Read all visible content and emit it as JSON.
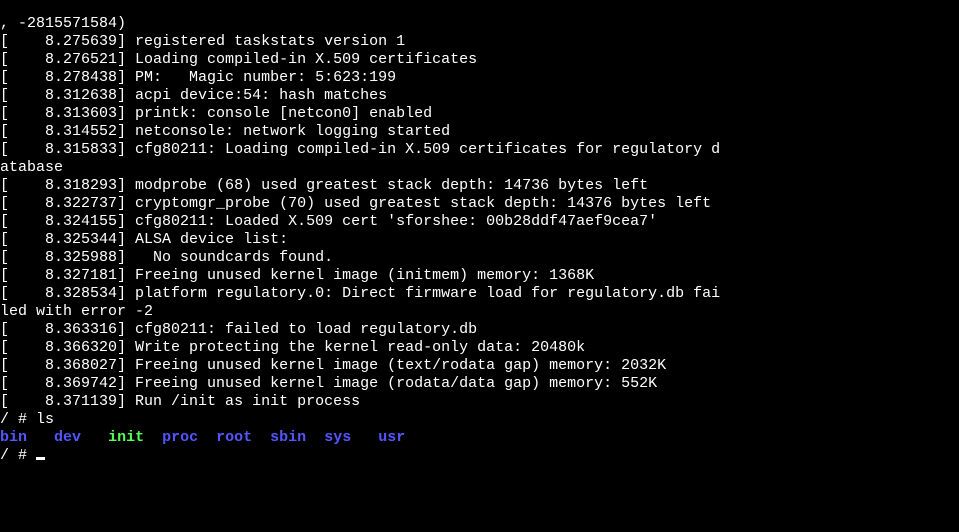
{
  "boot": {
    "frag": ", -2815571584)",
    "lines": [
      {
        "ts": "8.275639",
        "msg": "registered taskstats version 1"
      },
      {
        "ts": "8.276521",
        "msg": "Loading compiled-in X.509 certificates"
      },
      {
        "ts": "8.278438",
        "msg": "PM:   Magic number: 5:623:199"
      },
      {
        "ts": "8.312638",
        "msg": "acpi device:54: hash matches"
      },
      {
        "ts": "8.313603",
        "msg": "printk: console [netcon0] enabled"
      },
      {
        "ts": "8.314552",
        "msg": "netconsole: network logging started"
      },
      {
        "ts": "8.315833",
        "msg": "cfg80211: Loading compiled-in X.509 certificates for regulatory d"
      }
    ],
    "wrap1": "atabase",
    "lines2": [
      {
        "ts": "8.318293",
        "msg": "modprobe (68) used greatest stack depth: 14736 bytes left"
      },
      {
        "ts": "8.322737",
        "msg": "cryptomgr_probe (70) used greatest stack depth: 14376 bytes left"
      },
      {
        "ts": "8.324155",
        "msg": "cfg80211: Loaded X.509 cert 'sforshee: 00b28ddf47aef9cea7'"
      },
      {
        "ts": "8.325344",
        "msg": "ALSA device list:"
      },
      {
        "ts": "8.325988",
        "msg": "  No soundcards found."
      },
      {
        "ts": "8.327181",
        "msg": "Freeing unused kernel image (initmem) memory: 1368K"
      },
      {
        "ts": "8.328534",
        "msg": "platform regulatory.0: Direct firmware load for regulatory.db fai"
      }
    ],
    "wrap2": "led with error -2",
    "lines3": [
      {
        "ts": "8.363316",
        "msg": "cfg80211: failed to load regulatory.db"
      },
      {
        "ts": "8.366320",
        "msg": "Write protecting the kernel read-only data: 20480k"
      },
      {
        "ts": "8.368027",
        "msg": "Freeing unused kernel image (text/rodata gap) memory: 2032K"
      },
      {
        "ts": "8.369742",
        "msg": "Freeing unused kernel image (rodata/data gap) memory: 552K"
      },
      {
        "ts": "8.371139",
        "msg": "Run /init as init process"
      }
    ]
  },
  "shell": {
    "prompt1": "/ # ",
    "cmd1": "ls",
    "ls": {
      "bin": "bin",
      "dev": "dev",
      "init": "init",
      "proc": "proc",
      "root": "root",
      "sbin": "sbin",
      "sys": "sys",
      "usr": "usr"
    },
    "prompt2": "/ # "
  }
}
